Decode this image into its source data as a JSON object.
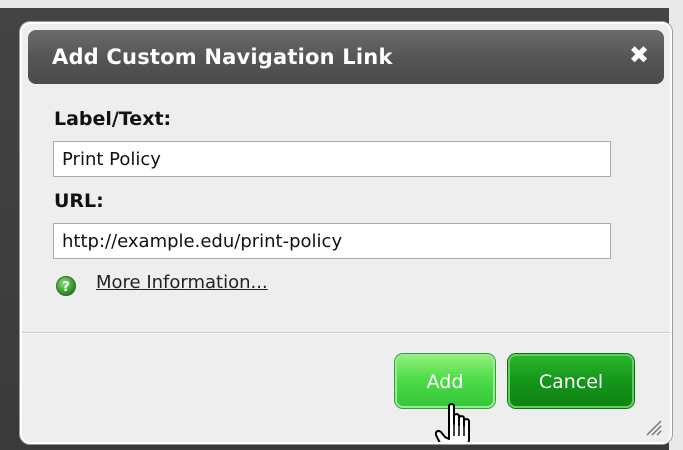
{
  "dialog": {
    "title": "Add Custom Navigation Link",
    "close_icon": "close-icon"
  },
  "form": {
    "label_field": {
      "label": "Label/Text:",
      "value": "Print Policy"
    },
    "url_field": {
      "label": "URL:",
      "value": "http://example.edu/print-policy"
    },
    "more_info": {
      "icon": "help-icon",
      "text": "More Information..."
    }
  },
  "buttons": {
    "add_label": "Add",
    "cancel_label": "Cancel"
  },
  "colors": {
    "titlebar": "#565656",
    "add_button": "#4fdc48",
    "cancel_button": "#15961a",
    "help_icon": "#45a83a"
  }
}
